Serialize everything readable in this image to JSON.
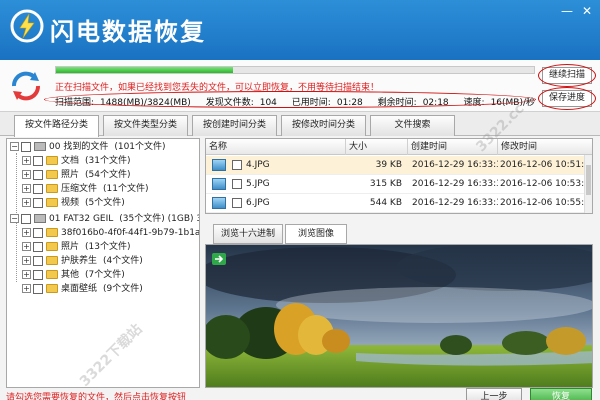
{
  "app": {
    "title": "闪电数据恢复"
  },
  "window_controls": {
    "minimize": "—",
    "close": "✕"
  },
  "scan": {
    "progress": 0.37,
    "message": "正在扫描文件，如果已经找到您丢失的文件，可以立即恢复，不用等待扫描结束！",
    "stats": {
      "range_label": "扫描范围:",
      "range_value": "1488(MB)/3824(MB)",
      "found_label": "发现文件数:",
      "found_value": "104",
      "elapsed_label": "已用时间:",
      "elapsed_value": "01:28",
      "remaining_label": "剩余时间:",
      "remaining_value": "02:18",
      "speed_label": "速度:",
      "speed_value": "16(MB)/秒"
    },
    "continue_label": "继续扫描",
    "save_label": "保存进度"
  },
  "tabs": [
    {
      "label": "按文件路径分类"
    },
    {
      "label": "按文件类型分类"
    },
    {
      "label": "按创建时间分类"
    },
    {
      "label": "按修改时间分类"
    },
    {
      "label": "文件搜索"
    }
  ],
  "tree": {
    "root1": {
      "code": "00",
      "name": "找到的文件",
      "count": "(101个文件)"
    },
    "children1": [
      {
        "name": "文档",
        "count": "(31个文件)"
      },
      {
        "name": "照片",
        "count": "(54个文件)"
      },
      {
        "name": "压缩文件",
        "count": "(11个文件)"
      },
      {
        "name": "视频",
        "count": "(5个文件)"
      }
    ],
    "root2": {
      "code": "01",
      "name": "FAT32 GEIL",
      "count": "(35个文件) (1GB) 3("
    },
    "children2": [
      {
        "name": "38f016b0-4f0f-44f1-9b79-1b1a24678",
        "count": ""
      },
      {
        "name": "照片",
        "count": "(13个文件)"
      },
      {
        "name": "护肤养生",
        "count": "(4个文件)"
      },
      {
        "name": "其他",
        "count": "(7个文件)"
      },
      {
        "name": "桌面壁纸",
        "count": "(9个文件)"
      }
    ]
  },
  "files": {
    "headers": {
      "name": "名称",
      "size": "大小",
      "created": "创建时间",
      "modified": "修改时间"
    },
    "rows": [
      {
        "name": "4.JPG",
        "size": "39 KB",
        "created": "2016-12-29 16:33:30",
        "modified": "2016-12-06 10:51:54"
      },
      {
        "name": "5.JPG",
        "size": "315 KB",
        "created": "2016-12-29 16:33:30",
        "modified": "2016-12-06 10:53:12"
      },
      {
        "name": "6.JPG",
        "size": "544 KB",
        "created": "2016-12-29 16:33:30",
        "modified": "2016-12-06 10:55:06"
      }
    ]
  },
  "preview": {
    "tabs": [
      {
        "label": "浏览十六进制"
      },
      {
        "label": "浏览图像"
      }
    ]
  },
  "bottom": {
    "message": "请勾选您需要恢复的文件，然后点击恢复按钮",
    "back_label": "上一步",
    "recover_label": "恢复"
  },
  "watermark": {
    "text": "3322下载站",
    "domain": "3322.cc"
  }
}
